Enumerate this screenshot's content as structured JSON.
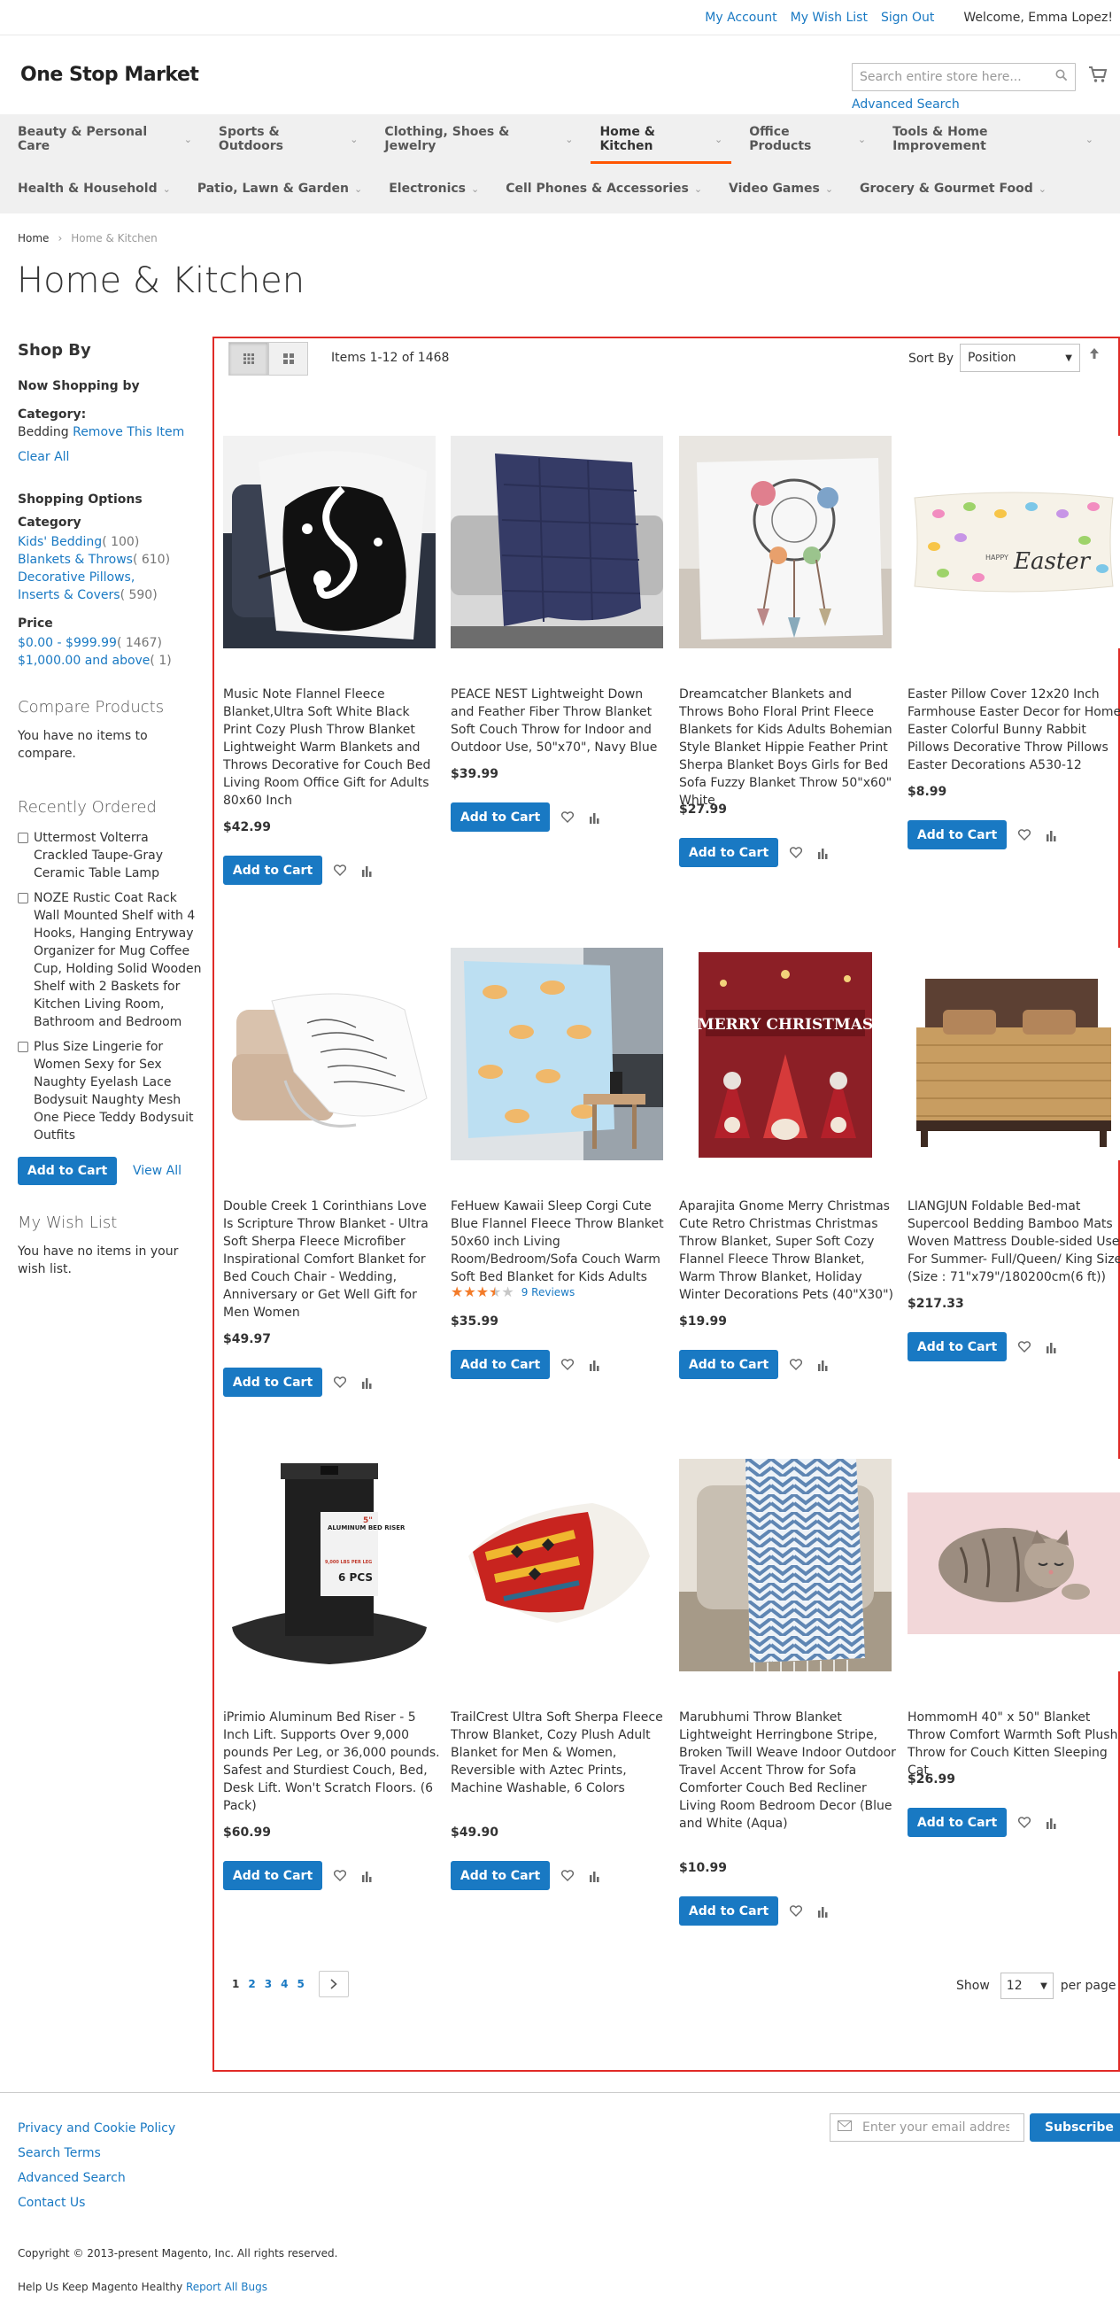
{
  "header_links": {
    "my_account": "My Account",
    "wish_list": "My Wish List",
    "sign_out": "Sign Out",
    "welcome": "Welcome, Emma Lopez!"
  },
  "logo": "One Stop Market",
  "search": {
    "placeholder": "Search entire store here...",
    "advanced": "Advanced Search"
  },
  "nav": {
    "row1": [
      "Beauty & Personal Care",
      "Sports & Outdoors",
      "Clothing, Shoes & Jewelry",
      "Home & Kitchen",
      "Office Products",
      "Tools & Home Improvement"
    ],
    "row2": [
      "Health & Household",
      "Patio, Lawn & Garden",
      "Electronics",
      "Cell Phones & Accessories",
      "Video Games",
      "Grocery & Gourmet Food"
    ],
    "active": "Home & Kitchen"
  },
  "breadcrumbs": {
    "home": "Home",
    "current": "Home & Kitchen"
  },
  "page_title": "Home & Kitchen",
  "sidebar": {
    "shop_by": "Shop By",
    "now_shopping": "Now Shopping by",
    "category_label": "Category:",
    "category_value": "Bedding",
    "remove": "Remove This Item",
    "clear_all": "Clear All",
    "shopping_options": "Shopping Options",
    "category_heading": "Category",
    "categories": [
      {
        "label": "Kids' Bedding",
        "count": "( 100)"
      },
      {
        "label": "Blankets & Throws",
        "count": "( 610)"
      },
      {
        "label": "Decorative Pillows, Inserts & Covers",
        "count": "( 590)"
      }
    ],
    "price_heading": "Price",
    "prices": [
      {
        "label": "$0.00 - $999.99",
        "count": "( 1467)"
      },
      {
        "label": "$1,000.00 and above",
        "count": "( 1)"
      }
    ],
    "compare_title": "Compare Products",
    "compare_empty": "You have no items to compare.",
    "recent_title": "Recently Ordered",
    "recent_items": [
      "Uttermost Volterra Crackled Taupe-Gray Ceramic Table Lamp",
      "NOZE Rustic Coat Rack Wall Mounted Shelf with 4 Hooks, Hanging Entryway Organizer for Mug Coffee Cup, Holding Solid Wooden Shelf with 2 Baskets for Kitchen Living Room, Bathroom and Bedroom",
      "Plus Size Lingerie for Women Sexy for Sex Naughty Eyelash Lace Bodysuit Naughty Mesh One Piece Teddy Bodysuit Outfits"
    ],
    "add_to_cart": "Add to Cart",
    "view_all": "View All",
    "wishlist_title": "My Wish List",
    "wishlist_empty": "You have no items in your wish list."
  },
  "toolbar": {
    "amount": "Items 1-12 of 1468",
    "sort_by": "Sort By",
    "sort_value": "Position"
  },
  "add_to_cart_label": "Add to Cart",
  "products": [
    {
      "name": "Music Note Flannel Fleece Blanket,Ultra Soft White Black Print Cozy Plush Throw Blanket Lightweight Warm Blankets and Throws Decorative for Couch Bed Living Room Office Gift for Adults 80x60 Inch",
      "price": "$42.99",
      "image": "music-note-blanket"
    },
    {
      "name": "PEACE NEST Lightweight Down and Feather Fiber Throw Blanket Soft Couch Throw for Indoor and Outdoor Use, 50\"x70\", Navy Blue",
      "price": "$39.99",
      "image": "navy-throw"
    },
    {
      "name": "Dreamcatcher Blankets and Throws Boho Floral Print Fleece Blankets for Kids Adults Bohemian Style Blanket Hippie Feather Print Sherpa Blanket Boys Girls for Bed Sofa Fuzzy Blanket Throw 50\"x60\" White",
      "price": "$27.99",
      "image": "dreamcatcher-blanket"
    },
    {
      "name": "Easter Pillow Cover 12x20 Inch Farmhouse Easter Decor for Home Easter Colorful Bunny Rabbit Pillows Decorative Throw Pillows Easter Decorations A530-12",
      "price": "$8.99",
      "image": "easter-pillow"
    },
    {
      "name": "Double Creek 1 Corinthians Love Is Scripture Throw Blanket - Ultra Soft Sherpa Fleece Microfiber Inspirational Comfort Blanket for Bed Couch Chair - Wedding, Anniversary or Get Well Gift for Men Women",
      "price": "$49.97",
      "image": "scripture-blanket"
    },
    {
      "name": "FeHuew Kawaii Sleep Corgi Cute Blue Flannel Fleece Throw Blanket 50x60 inch Living Room/Bedroom/Sofa Couch Warm Soft Bed Blanket for Kids Adults",
      "price": "$35.99",
      "image": "corgi-blanket",
      "rating": 3.5,
      "reviews": "9  Reviews"
    },
    {
      "name": "Aparajita Gnome Merry Christmas Cute Retro Christmas Christmas Throw Blanket, Super Soft Cozy Flannel Fleece Throw Blanket, Warm Throw Blanket, Holiday Winter Decorations Pets  (40\"X30\")",
      "price": "$19.99",
      "image": "christmas-gnome-blanket"
    },
    {
      "name": "LIANGJUN Foldable Bed-mat Supercool Bedding Bamboo Mats Woven Mattress Double-sided Use For Summer- Full/Queen/ King Size (Size : 71\"x79\"/180200cm(6 ft))",
      "price": "$217.33",
      "image": "bamboo-mat"
    },
    {
      "name": "iPrimio Aluminum Bed Riser - 5 Inch Lift. Supports Over 9,000 pounds Per Leg, or 36,000 pounds. Safest and Sturdiest Couch, Bed, Desk Lift. Won't Scratch Floors. (6 Pack)",
      "price": "$60.99",
      "image": "bed-riser",
      "riser_label": "ALUMINUM BED RISER",
      "riser_size": "5\"",
      "riser_weight": "9,000 LBS PER LEG",
      "riser_pack": "6 PCS"
    },
    {
      "name": "TrailCrest Ultra Soft Sherpa Fleece Throw Blanket, Cozy Plush Adult Blanket for Men & Women, Reversible with Aztec Prints, Machine Washable, 6 Colors",
      "price": "$49.90",
      "image": "aztec-blanket"
    },
    {
      "name": "Marubhumi Throw Blanket Lightweight Herringbone Stripe, Broken Twill Weave Indoor Outdoor Travel Accent Throw for Sofa Comforter Couch Bed Recliner Living Room Bedroom Decor (Blue and White (Aqua)",
      "price": "$10.99",
      "image": "herringbone-throw"
    },
    {
      "name": "HommomH 40\" x 50\" Blanket Throw Comfort Warmth Soft Plush Throw for Couch Kitten Sleeping Cat",
      "price": "$26.99",
      "image": "kitten-blanket"
    }
  ],
  "christmas_text": "MERRY CHRISTMAS",
  "easter_text": "Easter",
  "easter_happy": "HAPPY",
  "pagination": {
    "pages": [
      "1",
      "2",
      "3",
      "4",
      "5"
    ],
    "current": "1"
  },
  "limiter": {
    "show": "Show",
    "value": "12",
    "per_page": "per page"
  },
  "footer": {
    "links": [
      "Privacy and Cookie Policy",
      "Search Terms",
      "Advanced Search",
      "Contact Us"
    ],
    "newsletter_placeholder": "Enter your email address",
    "subscribe": "Subscribe",
    "copyright": "Copyright © 2013-present Magento, Inc. All rights reserved.",
    "help_text": "Help Us Keep Magento Healthy",
    "report_bugs": "Report All Bugs"
  },
  "colors": {
    "link": "#1979c3",
    "button": "#1979c3",
    "nav_active": "#ff5501",
    "highlight_border": "#e02b27",
    "star": "#f37b29"
  }
}
